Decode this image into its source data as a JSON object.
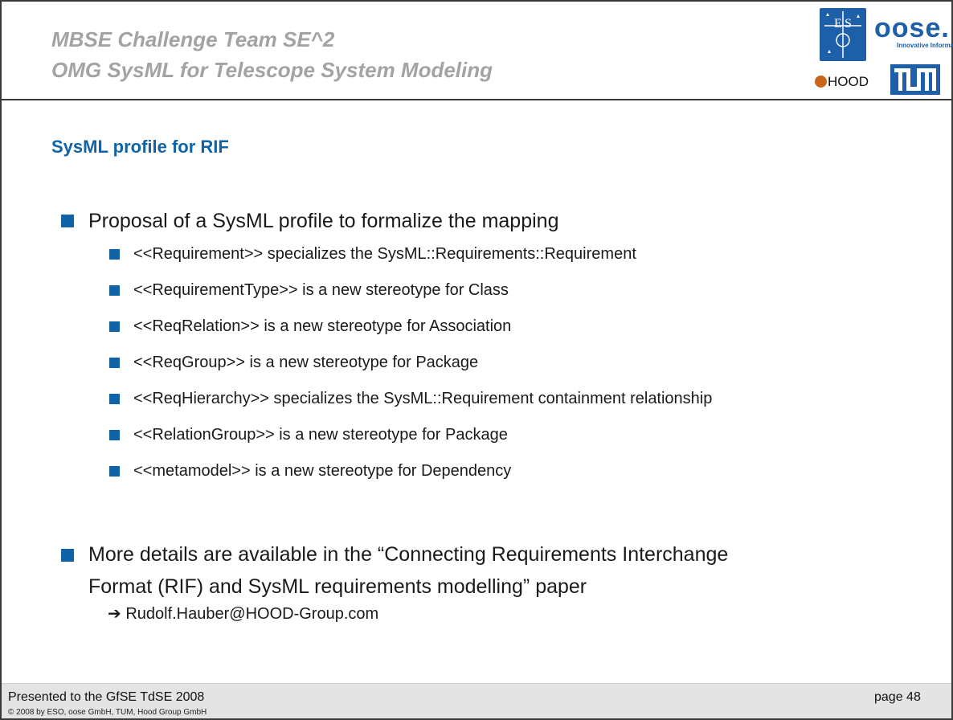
{
  "header": {
    "title_line1": "MBSE Challenge Team SE^2",
    "title_line2": "OMG SysML for Telescope System Modeling",
    "logos": {
      "eso_text": "ES O",
      "oose_word": "oose.",
      "oose_subtitle": "Innovative Informatik",
      "hood_word": "HOOD",
      "tum_text": "TUM"
    }
  },
  "slide": {
    "title": "SysML profile for RIF",
    "bullets": [
      {
        "text": "Proposal of a SysML profile to formalize the mapping",
        "sub": [
          "<<Requirement>> specializes the SysML::Requirements::Requirement",
          "<<RequirementType>> is a new stereotype for Class",
          "<<ReqRelation>> is a new stereotype for Association",
          "<<ReqGroup>> is a new stereotype for Package",
          "<<ReqHierarchy>> specializes the SysML::Requirement containment relationship",
          "<<RelationGroup>> is a new stereotype for Package",
          "<<metamodel>> is a new stereotype for Dependency"
        ]
      },
      {
        "text_line1": "More details are available in the “Connecting Requirements Interchange",
        "text_line2": "Format (RIF) and SysML requirements modelling” paper",
        "contact": "➔ Rudolf.Hauber@HOOD-Group.com"
      }
    ]
  },
  "footer": {
    "presented": "Presented to the GfSE TdSE 2008",
    "copyright": "© 2008 by ESO, oose GmbH, TUM, Hood Group GmbH",
    "page": "page 48"
  },
  "colors": {
    "accent_blue": "#0f63a6",
    "title_gray": "#a3a3a3",
    "footer_bg": "#e4e4e4"
  }
}
